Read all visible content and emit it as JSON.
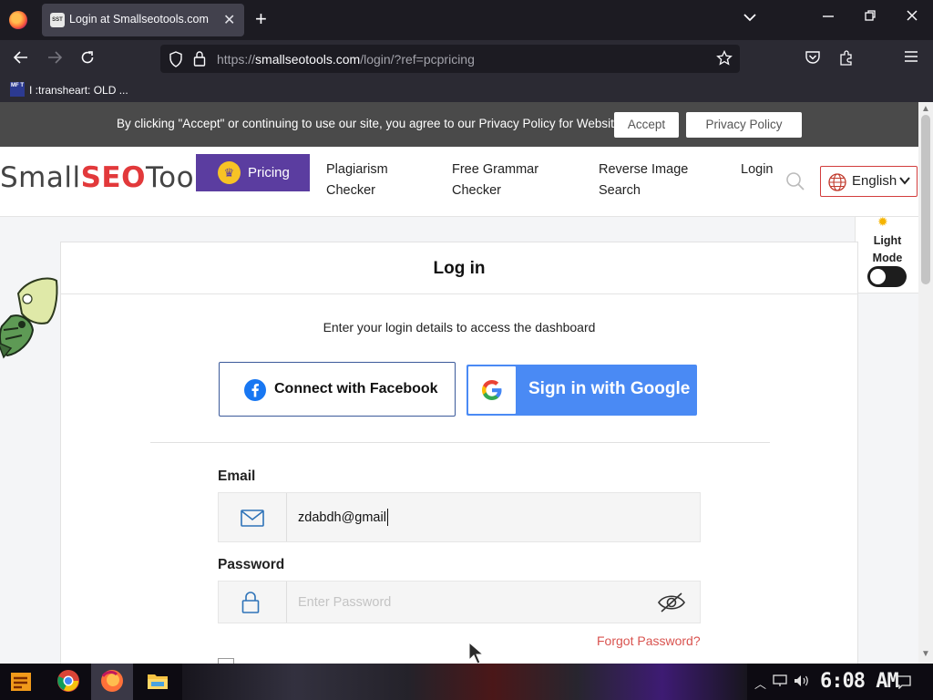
{
  "browser": {
    "tab_title": "Login at Smallseotools.com",
    "tab_favicon_text": "SST",
    "url_prefix": "https://",
    "url_domain": "smallseotools.com",
    "url_path": "/login/?ref=pcpricing",
    "bookmark_badge": "MF T",
    "bookmark_label": "I :transheart: OLD ..."
  },
  "cookie_bar": {
    "text": "By clicking \"Accept\" or continuing to use our site, you agree to our Privacy Policy for Website",
    "accept_label": "Accept",
    "policy_label": "Privacy Policy"
  },
  "header": {
    "logo_small": "Small",
    "logo_seo": "SEO",
    "logo_tools": "Tools",
    "pricing_label": "Pricing",
    "nav": [
      {
        "line1": "Plagiarism",
        "line2": "Checker"
      },
      {
        "line1": "Free Grammar",
        "line2": "Checker"
      },
      {
        "line1": "Reverse Image",
        "line2": "Search"
      },
      {
        "line1": "Login",
        "line2": ""
      }
    ],
    "language": "English"
  },
  "mode_panel": {
    "line1": "Light",
    "line2": "Mode"
  },
  "login": {
    "title": "Log in",
    "subtitle": "Enter your login details to access the dashboard",
    "facebook_label": "Connect with Facebook",
    "google_label": "Sign in with Google",
    "email_label": "Email",
    "email_value": "zdabdh@gmail",
    "password_label": "Password",
    "password_placeholder": "Enter Password",
    "forgot_label": "Forgot Password?"
  },
  "taskbar": {
    "clock": "6:08 AM"
  },
  "colors": {
    "pricing_purple": "#5b3da0",
    "google_blue": "#4a8af4",
    "facebook_blue": "#1877f2",
    "forgot_red": "#d9534f",
    "logo_red": "#e2393b",
    "logo_blue": "#2e73b8"
  },
  "icons": [
    "firefox-icon",
    "close-icon",
    "plus-icon",
    "chevron-down-icon",
    "back-icon",
    "forward-icon",
    "reload-icon",
    "shield-icon",
    "lock-icon",
    "star-icon",
    "pocket-icon",
    "extensions-icon",
    "menu-icon",
    "crown-icon",
    "search-icon",
    "globe-icon",
    "sun-icon",
    "facebook-icon",
    "google-icon",
    "mail-icon",
    "lock-icon",
    "eye-slash-icon"
  ]
}
